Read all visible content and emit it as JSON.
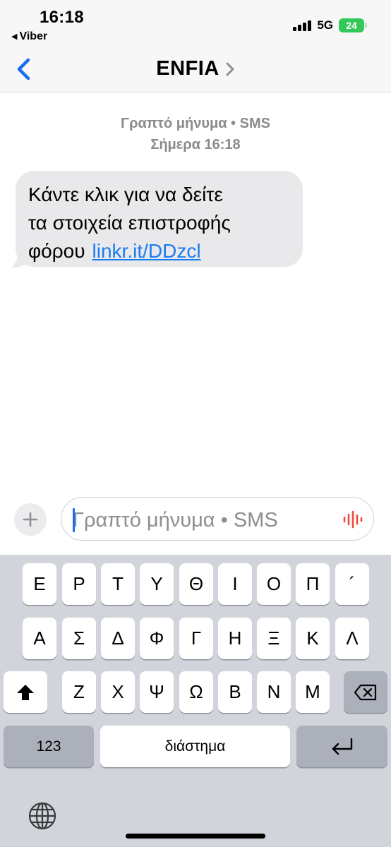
{
  "status_bar": {
    "time": "16:18",
    "back_app": "Viber",
    "network": "5G",
    "battery": "24"
  },
  "nav": {
    "title": "ENFIA"
  },
  "conversation": {
    "meta_service": "Γραπτό μήνυμα • SMS",
    "meta_time": "Σήμερα 16:18",
    "message": {
      "line1": "Κάντε κλικ για να δείτε",
      "line2": "τα στοιχεία επιστροφής",
      "line3": "φόρου",
      "link": "linkr.it/DDzcl"
    }
  },
  "compose": {
    "placeholder": "Γραπτό μήνυμα • SMS"
  },
  "keyboard": {
    "row1": [
      "Ε",
      "Ρ",
      "Τ",
      "Υ",
      "Θ",
      "Ι",
      "Ο",
      "Π",
      "´"
    ],
    "row2": [
      "Α",
      "Σ",
      "Δ",
      "Φ",
      "Γ",
      "Η",
      "Ξ",
      "Κ",
      "Λ"
    ],
    "row3": [
      "Ζ",
      "Χ",
      "Ψ",
      "Ω",
      "Β",
      "Ν",
      "Μ"
    ],
    "numbers_key": "123",
    "space_key": "διάστημα"
  },
  "colors": {
    "accent": "#1a6cf0",
    "link": "#1a7cf1",
    "battery": "#34c759",
    "bubble": "#e9e9eb",
    "keyboard_bg": "#d1d4da"
  }
}
